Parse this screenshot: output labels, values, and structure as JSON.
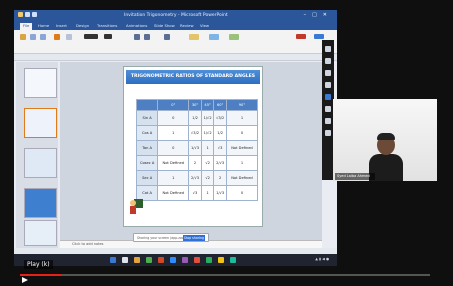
{
  "window": {
    "title": "Invitation Trigonometry - Microsoft PowerPoint"
  },
  "ribbon": {
    "tabs": [
      "File",
      "Home",
      "Insert",
      "Design",
      "Transitions",
      "Animations",
      "Slide Show",
      "Review",
      "View"
    ]
  },
  "slide": {
    "title": "TRIGONOMETRIC RATIOS OF STANDARD ANGLES",
    "columns": [
      "",
      "0°",
      "30°",
      "45°",
      "60°",
      "90°"
    ],
    "rows": [
      {
        "label": "Sin A",
        "values": [
          "0",
          "1/2",
          "1/√2",
          "√3/2",
          "1"
        ]
      },
      {
        "label": "Cos A",
        "values": [
          "1",
          "√3/2",
          "1/√2",
          "1/2",
          "0"
        ]
      },
      {
        "label": "Tan A",
        "values": [
          "0",
          "1/√3",
          "1",
          "√3",
          "Not Defined"
        ]
      },
      {
        "label": "Cosec A",
        "values": [
          "Not Defined",
          "2",
          "√2",
          "2/√3",
          "1"
        ]
      },
      {
        "label": "Sec A",
        "values": [
          "1",
          "2/√3",
          "√2",
          "2",
          "Not Defined"
        ]
      },
      {
        "label": "Cot A",
        "values": [
          "Not Defined",
          "√3",
          "1",
          "1/√3",
          "0"
        ]
      }
    ]
  },
  "notes": {
    "placeholder": "Click to add notes"
  },
  "popup": {
    "text": "Sharing your screen (app.zoom.us)",
    "button": "Stop sharing"
  },
  "webcam": {
    "name": "Syed Laiba Ahmed"
  },
  "player": {
    "play_label": "Play (k)",
    "progress": 0.1
  },
  "colors": {
    "accent": "#2b579a",
    "progress": "#e62117"
  }
}
